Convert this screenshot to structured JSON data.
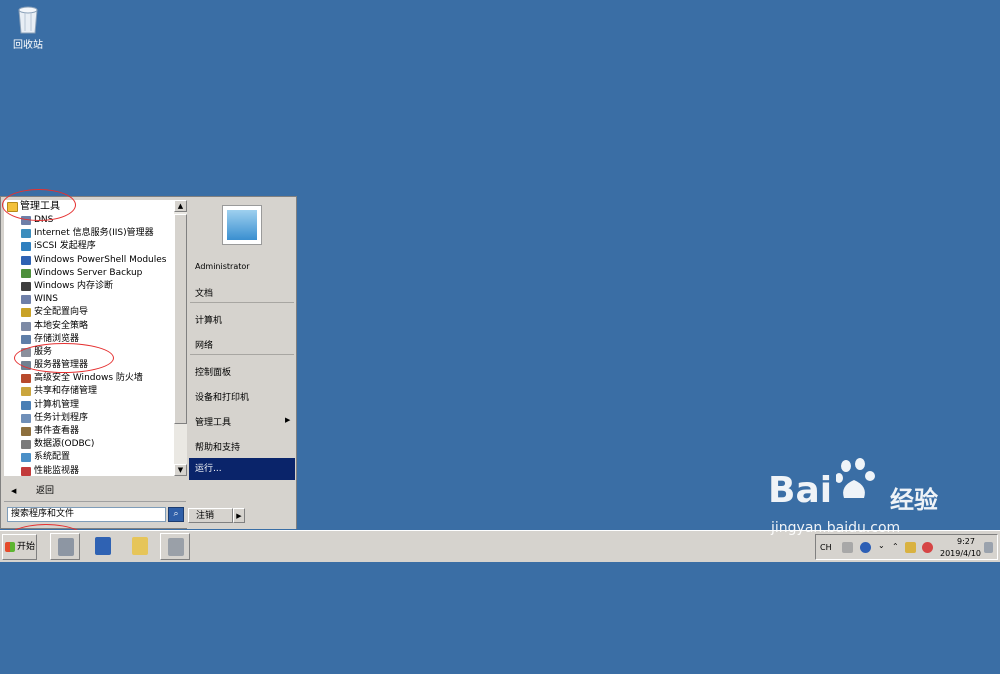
{
  "desktop": {
    "recycle_bin_label": "回收站"
  },
  "start_menu": {
    "programs": [
      {
        "label": "管理工具",
        "icon": "folder-icon",
        "color": "#f3c13a",
        "level": 0
      },
      {
        "label": "DNS",
        "icon": "dns-icon",
        "color": "#6e7fa8",
        "level": 1
      },
      {
        "label": "Internet 信息服务(IIS)管理器",
        "icon": "iis-icon",
        "color": "#3b8dbd",
        "level": 1
      },
      {
        "label": "iSCSI 发起程序",
        "icon": "globe-icon",
        "color": "#2e7fbf",
        "level": 1
      },
      {
        "label": "Windows PowerShell Modules",
        "icon": "powershell-icon",
        "color": "#2f62b3",
        "level": 1
      },
      {
        "label": "Windows Server Backup",
        "icon": "backup-icon",
        "color": "#4c8f3a",
        "level": 1
      },
      {
        "label": "Windows 内存诊断",
        "icon": "memory-icon",
        "color": "#3d3d3d",
        "level": 1
      },
      {
        "label": "WINS",
        "icon": "wins-icon",
        "color": "#6e7fa8",
        "level": 1
      },
      {
        "label": "安全配置向导",
        "icon": "security-wizard-icon",
        "color": "#c9a227",
        "level": 1
      },
      {
        "label": "本地安全策略",
        "icon": "local-policy-icon",
        "color": "#7d8aa5",
        "level": 1
      },
      {
        "label": "存储浏览器",
        "icon": "storage-icon",
        "color": "#5e7ea8",
        "level": 1
      },
      {
        "label": "服务",
        "icon": "services-icon",
        "color": "#8a8f9c",
        "level": 1
      },
      {
        "label": "服务器管理器",
        "icon": "server-manager-icon",
        "color": "#708090",
        "level": 1
      },
      {
        "label": "高级安全 Windows 防火墙",
        "icon": "firewall-icon",
        "color": "#b84a2c",
        "level": 1
      },
      {
        "label": "共享和存储管理",
        "icon": "share-icon",
        "color": "#caa53d",
        "level": 1
      },
      {
        "label": "计算机管理",
        "icon": "computer-management-icon",
        "color": "#4a7fb5",
        "level": 1
      },
      {
        "label": "任务计划程序",
        "icon": "scheduler-icon",
        "color": "#6f8fb8",
        "level": 1
      },
      {
        "label": "事件查看器",
        "icon": "event-viewer-icon",
        "color": "#8d6f3d",
        "level": 1
      },
      {
        "label": "数据源(ODBC)",
        "icon": "odbc-icon",
        "color": "#7a7a7a",
        "level": 1
      },
      {
        "label": "系统配置",
        "icon": "system-config-icon",
        "color": "#4a8fc7",
        "level": 1
      },
      {
        "label": "性能监视器",
        "icon": "performance-icon",
        "color": "#c23a3a",
        "level": 1
      }
    ],
    "back_label": "返回",
    "search_placeholder": "搜索程序和文件",
    "right": {
      "user": "Administrator",
      "documents": "文档",
      "computer": "计算机",
      "network": "网络",
      "control_panel": "控制面板",
      "devices_printers": "设备和打印机",
      "admin_tools": "管理工具",
      "help": "帮助和支持",
      "run": "运行..."
    },
    "logoff_label": "注销"
  },
  "taskbar": {
    "start_label": "开始",
    "tray": {
      "lang": "CH",
      "time": "9:27",
      "date": "2019/4/10"
    }
  },
  "watermark": {
    "brand": "Bai",
    "brand_suffix": "经验",
    "url": "jingyan.baidu.com"
  },
  "colors": {
    "desktop": "#3a6ea5",
    "highlight": "#0a246a",
    "annotation": "#e53030"
  }
}
